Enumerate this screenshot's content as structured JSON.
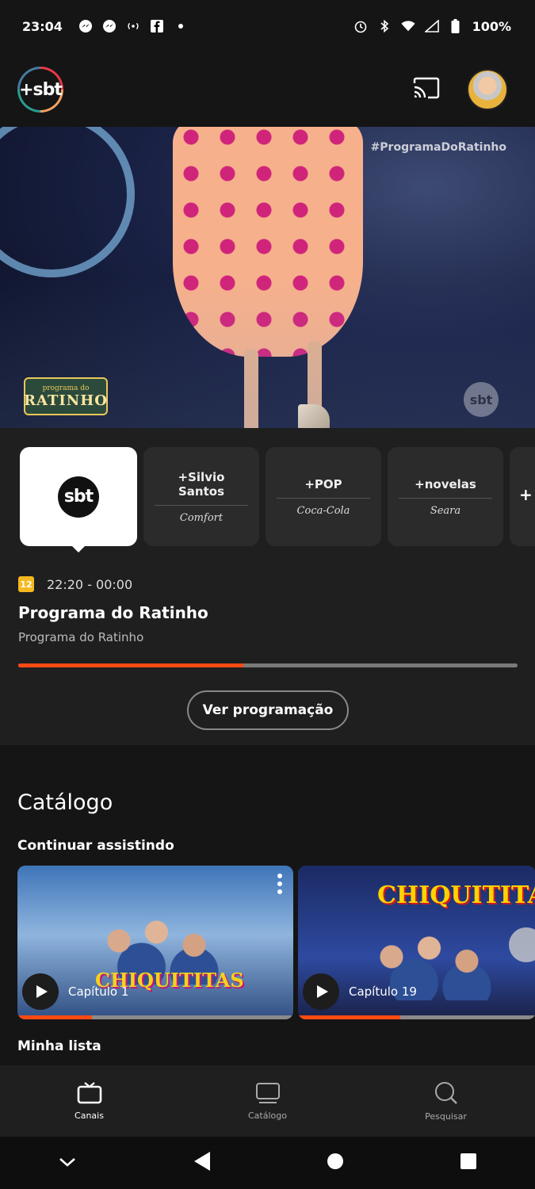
{
  "status_bar": {
    "time": "23:04",
    "left_icons": [
      "messenger-icon",
      "messenger-icon",
      "radio-icon",
      "facebook-icon",
      "dot-icon"
    ],
    "right_icons": [
      "alarm-icon",
      "bluetooth-icon",
      "wifi-icon",
      "signal-icon",
      "battery-icon"
    ],
    "battery": "100%"
  },
  "header": {
    "logo_text": "+sbt",
    "cast_icon": "cast-icon",
    "avatar_icon": "avatar-icon"
  },
  "player": {
    "hashtag": "#ProgramaDoRatinho",
    "show_logo_top": "programa do",
    "show_logo_main": "RATINHO",
    "watermark": "sbt"
  },
  "channels": [
    {
      "id": "sbt",
      "logo": "sbt",
      "active": true
    },
    {
      "id": "silvio-santos",
      "title": "+Silvio Santos",
      "sponsor": "Comfort"
    },
    {
      "id": "pop",
      "title": "+POP",
      "sponsor": "Coca-Cola"
    },
    {
      "id": "novelas",
      "title": "+novelas",
      "sponsor": "Seara"
    },
    {
      "id": "more",
      "title": "+"
    }
  ],
  "program": {
    "rating": "12",
    "time": "22:20 - 00:00",
    "title": "Programa do Ratinho",
    "subtitle": "Programa do Ratinho",
    "progress": 0.45,
    "schedule_button": "Ver programação"
  },
  "catalog": {
    "title": "Catálogo",
    "continue_label": "Continuar assistindo",
    "cards": [
      {
        "brand": "CHIQUITITAS",
        "episode": "Capítulo 1",
        "progress": 0.27
      },
      {
        "brand": "CHIQUITITAS",
        "episode": "Capítulo 19",
        "progress": 0.43
      }
    ],
    "my_list_label": "Minha lista"
  },
  "bottom_nav": {
    "items": [
      {
        "label": "Canais",
        "icon": "tv-icon",
        "active": true
      },
      {
        "label": "Catálogo",
        "icon": "monitor-icon",
        "active": false
      },
      {
        "label": "Pesquisar",
        "icon": "search-icon",
        "active": false
      }
    ]
  },
  "colors": {
    "accent": "#ff4a14",
    "background": "#151515",
    "panel": "#1f1f1f",
    "rating": "#f5b820"
  }
}
